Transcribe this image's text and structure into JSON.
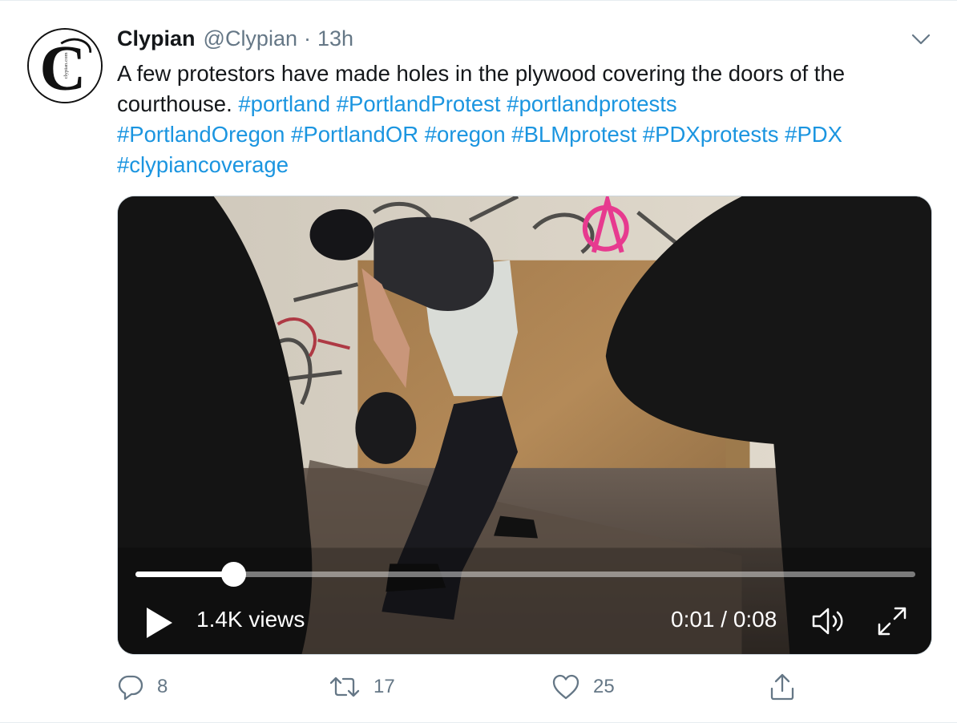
{
  "tweet": {
    "author_name": "Clypian",
    "handle": "@Clypian",
    "separator": "·",
    "time": "13h",
    "avatar_letter": "C",
    "avatar_small_text": "clypian.com",
    "text_plain": "A few protestors have made holes in the plywood covering the doors of the courthouse. ",
    "hashtags": [
      "#portland",
      "#PortlandProtest",
      "#portlandprotests",
      "#PortlandOregon",
      "#PortlandOR",
      "#oregon",
      "#BLMprotest",
      "#PDXprotests",
      "#PDX",
      "#clypiancoverage"
    ]
  },
  "video": {
    "views": "1.4K views",
    "timecode": "0:01 / 0:08",
    "progress": 0.125
  },
  "actions": {
    "reply_count": "8",
    "retweet_count": "17",
    "like_count": "25"
  },
  "icons": {
    "caret": "chevron-down-icon",
    "reply": "reply-icon",
    "retweet": "retweet-icon",
    "like": "heart-icon",
    "share": "share-icon",
    "play": "play-icon",
    "volume": "volume-icon",
    "fullscreen": "fullscreen-icon"
  },
  "colors": {
    "link": "#1b95e0",
    "secondary_text": "#657786",
    "primary_text": "#14171a",
    "border": "#e6ecf0"
  }
}
